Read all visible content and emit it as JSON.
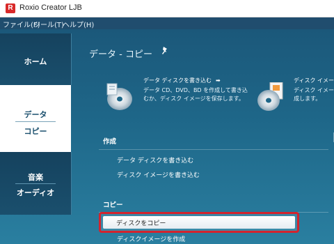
{
  "titlebar": {
    "title": "Roxio Creator LJB",
    "app_icon_letter": "R",
    "icon_color": "#d92a2a"
  },
  "menu": [
    "ファイル(F)",
    "ツール(T)",
    "ヘルプ(H)"
  ],
  "nav": {
    "home": "ホーム",
    "data_copy": [
      "データ",
      "コピー"
    ],
    "music_audio": [
      "音楽",
      "オーディオ"
    ]
  },
  "page": {
    "title": "データ - コピー",
    "pin_icon": "pin-icon"
  },
  "cards": [
    {
      "title": "データ ディスクを書き込む",
      "arrow": "➡",
      "desc": "データ CD、DVD、BD を作成して書き込むか、ディスク イメージを保存します。",
      "icon": "data-disc-icon"
    },
    {
      "title": "ディスク イメージ",
      "desc_lines": [
        "ディスク イメージ",
        "成します。"
      ],
      "icon": "disc-image-icon"
    }
  ],
  "sections": {
    "create": {
      "label": "作成",
      "tasks": [
        "データ ディスクを書き込む",
        "ディスク イメージを書き込む"
      ]
    },
    "copy": {
      "label": "コピー",
      "tasks": [
        "ディスクをコピー",
        "ディスクイメージを作成"
      ]
    }
  },
  "colors": {
    "menubar": "#204d6e",
    "content_bg": "#1e6688",
    "highlight_border": "#d3232e"
  }
}
